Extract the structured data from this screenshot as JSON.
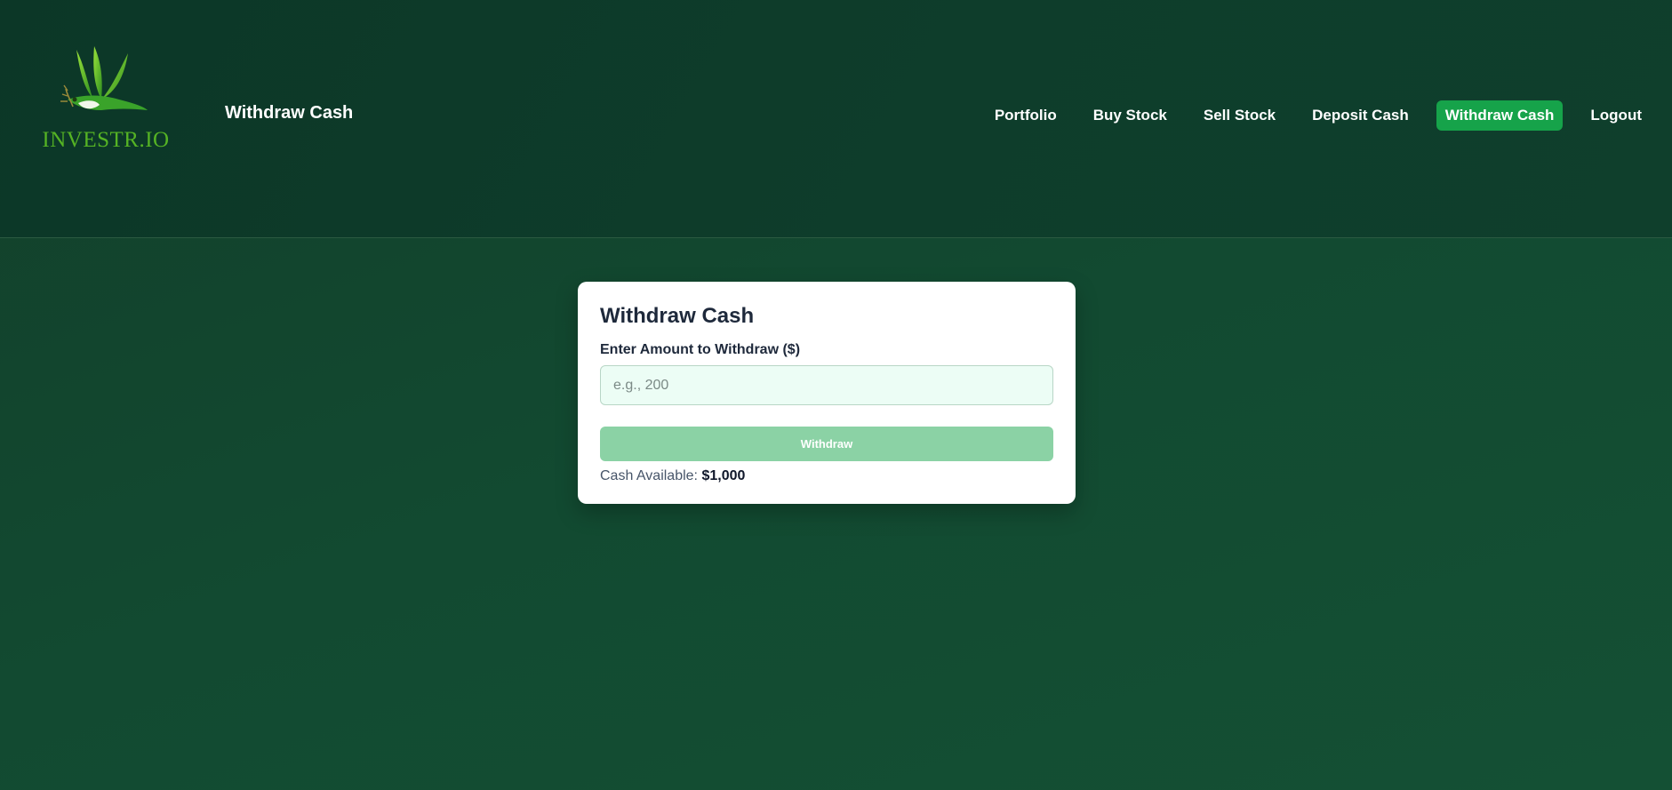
{
  "header": {
    "logo": {
      "text": "INVESTR.IO",
      "icon": "swallow-bird-logo"
    },
    "page_heading": "Withdraw Cash"
  },
  "nav": {
    "items": [
      {
        "label": "Portfolio"
      },
      {
        "label": "Buy Stock"
      },
      {
        "label": "Sell Stock"
      },
      {
        "label": "Deposit Cash"
      },
      {
        "label": "Withdraw Cash",
        "active": true
      },
      {
        "label": "Logout"
      }
    ]
  },
  "card": {
    "title": "Withdraw Cash",
    "amount_label": "Enter Amount to Withdraw ($)",
    "amount_placeholder": "e.g., 200",
    "amount_value": "",
    "button_label": "Withdraw",
    "cash_label": "Cash Available:",
    "cash_value": "$1,000"
  },
  "colors": {
    "accent": "#16a34a",
    "button_disabled": "#8bd2a5",
    "input_bg": "#ecfdf5",
    "logo_text": "#55b324"
  }
}
